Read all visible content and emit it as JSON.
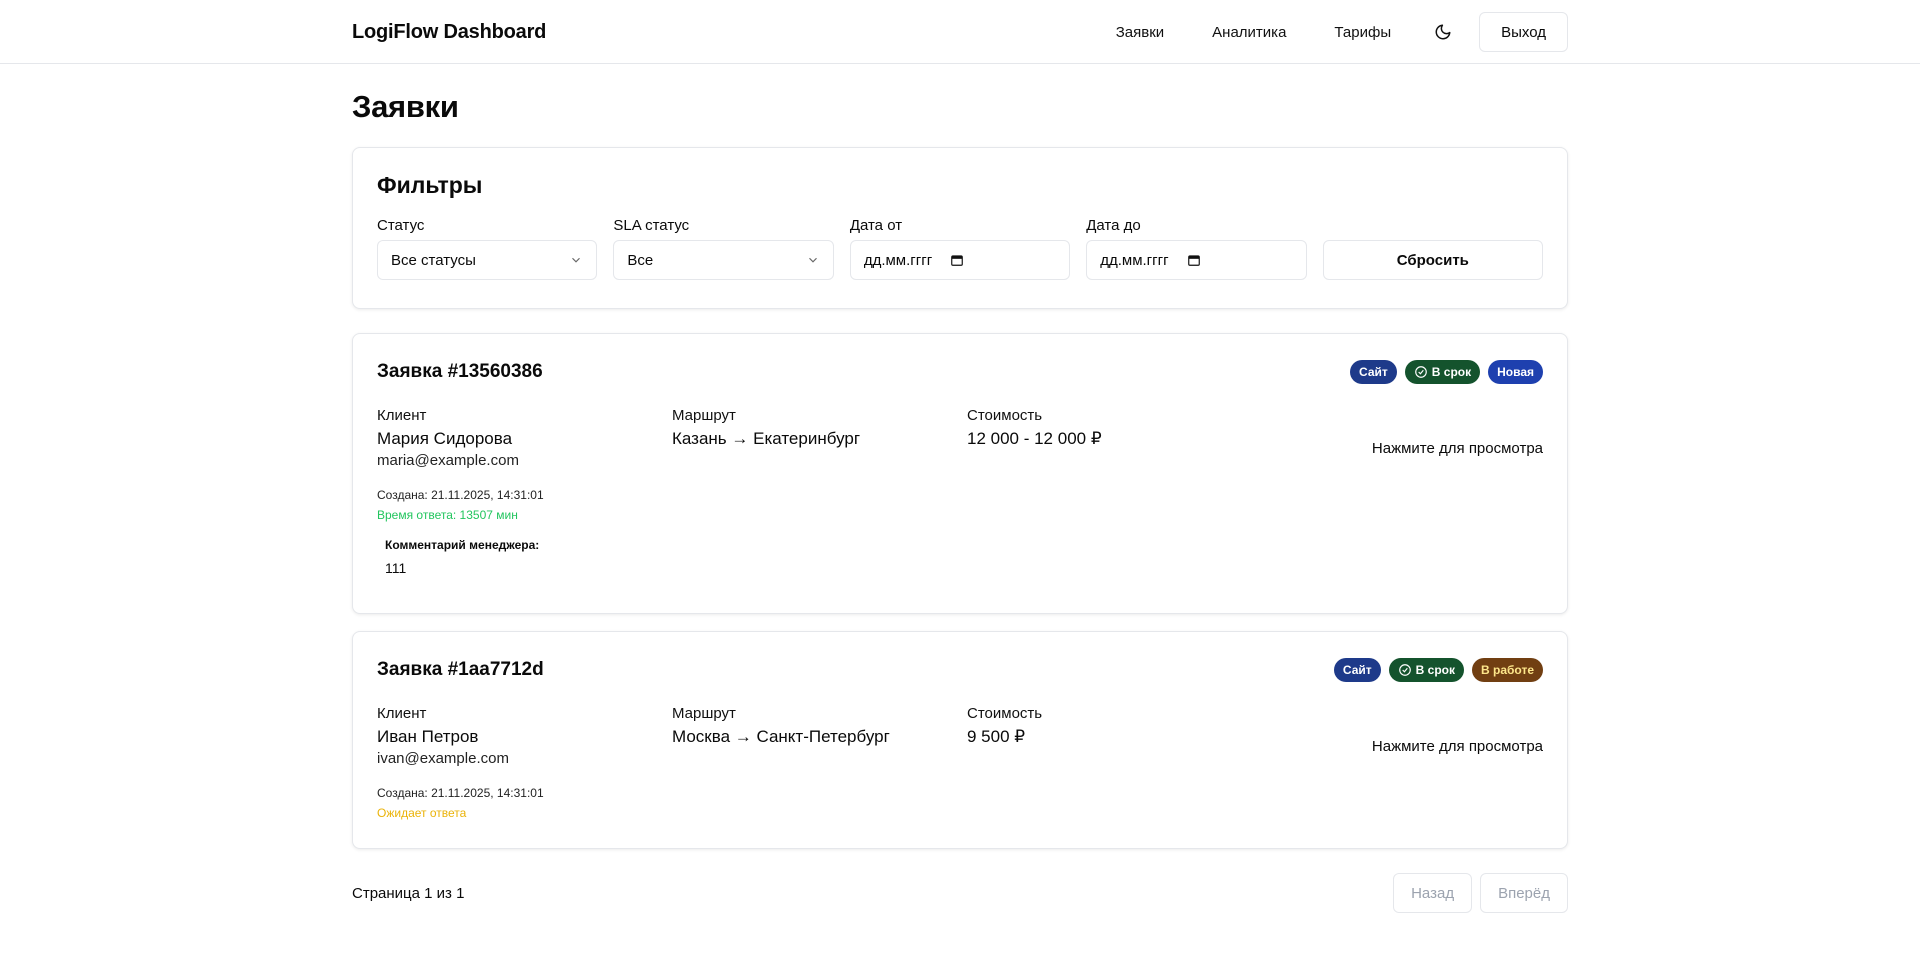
{
  "header": {
    "brand": "LogiFlow Dashboard",
    "nav": [
      "Заявки",
      "Аналитика",
      "Тарифы"
    ],
    "theme_icon": "moon-icon",
    "logout": "Выход"
  },
  "page": {
    "title": "Заявки"
  },
  "filters": {
    "title": "Фильтры",
    "status": {
      "label": "Статус",
      "value": "Все статусы"
    },
    "sla": {
      "label": "SLA статус",
      "value": "Все"
    },
    "date_from": {
      "label": "Дата от",
      "value": "дд.мм.гггг"
    },
    "date_to": {
      "label": "Дата до",
      "value": "дд.мм.гггг"
    },
    "reset": "Сбросить"
  },
  "orders": [
    {
      "title": "Заявка #13560386",
      "badges": [
        "Сайт",
        "В срок",
        "Новая"
      ],
      "client_label": "Клиент",
      "client_name": "Мария Сидорова",
      "client_email": "maria@example.com",
      "route_label": "Маршрут",
      "route": "Казань → Екатеринбург",
      "cost_label": "Стоимость",
      "cost": "12 000 - 12 000 ₽",
      "view": "Нажмите для просмотра",
      "created": "Создана: 21.11.2025, 14:31:01",
      "response": "Время ответа: 13507 мин",
      "comment_label": "Комментарий менеджера:",
      "comment": "111"
    },
    {
      "title": "Заявка #1aa7712d",
      "badges": [
        "Сайт",
        "В срок",
        "В работе"
      ],
      "client_label": "Клиент",
      "client_name": "Иван Петров",
      "client_email": "ivan@example.com",
      "route_label": "Маршрут",
      "route": "Москва → Санкт-Петербург",
      "cost_label": "Стоимость",
      "cost": "9 500 ₽",
      "view": "Нажмите для просмотра",
      "created": "Создана: 21.11.2025, 14:31:01",
      "response": "Ожидает ответа"
    }
  ],
  "pagination": {
    "info": "Страница 1 из 1",
    "prev": "Назад",
    "next": "Вперёд"
  },
  "colors": {
    "on_time_text": "#22c55e",
    "waiting_text": "#eab308",
    "badge_blue": "#1e3a8a",
    "badge_green": "#14532d",
    "badge_brown": "#713f12"
  }
}
